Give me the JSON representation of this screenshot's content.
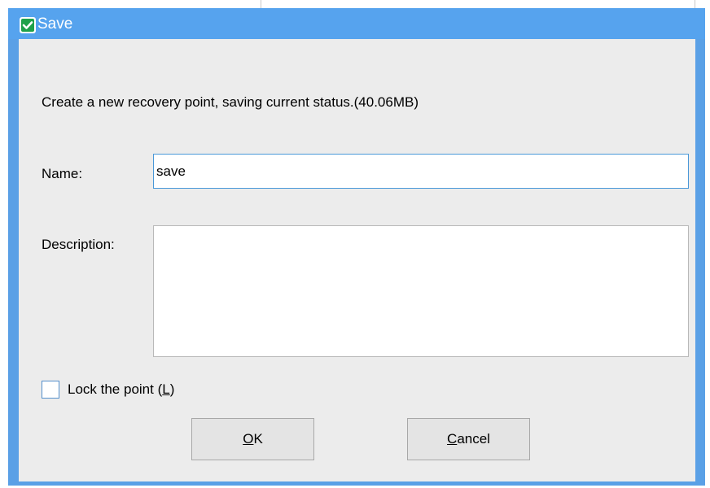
{
  "window": {
    "title": "Save"
  },
  "dialog": {
    "message": "Create a new recovery point, saving current status.(40.06MB)",
    "name_label": "Name:",
    "name_value": "save",
    "description_label": "Description:",
    "description_value": "",
    "lock_label_prefix": "Lock the point (",
    "lock_label_key": "L",
    "lock_label_suffix": ")",
    "lock_checked": false
  },
  "buttons": {
    "ok_key": "O",
    "ok_rest": "K",
    "cancel_key": "C",
    "cancel_rest": "ancel"
  },
  "colors": {
    "titlebar": "#56a3ee",
    "client_background": "#ececec",
    "icon_green": "#1fa14a"
  },
  "icons": {
    "title_icon": "green-shield-check-icon"
  }
}
